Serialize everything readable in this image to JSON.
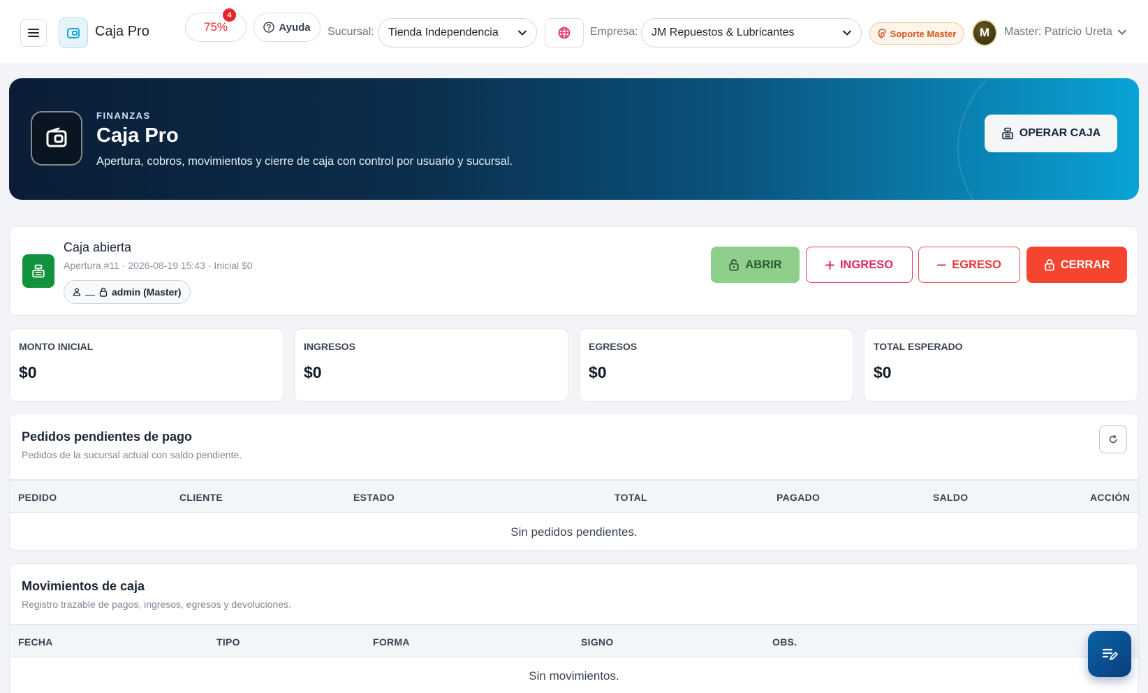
{
  "topbar": {
    "app_title": "Caja Pro",
    "progress_label": "75%",
    "progress_value": 75,
    "notification_count": "4",
    "help_label": "Ayuda",
    "branch_label": "Sucursal:",
    "branch_value": "Tienda Independencia",
    "company_label": "Empresa:",
    "company_value": "JM Repuestos & Lubricantes",
    "support_label": "Soporte Master",
    "avatar_initial": "M",
    "user_name": "Master: Patricio Ureta"
  },
  "hero": {
    "kicker": "FINANZAS",
    "title": "Caja Pro",
    "subtitle": "Apertura, cobros, movimientos y cierre de caja con control por usuario y sucursal.",
    "button_label": "OPERAR CAJA"
  },
  "caja": {
    "status_title": "Caja abierta",
    "meta": "Apertura #11 · 2026-08-19 15:43 · Inicial $0",
    "user_badge": "admin (Master)",
    "buttons": {
      "abrir": "ABRIR",
      "ingreso": "INGRESO",
      "egreso": "EGRESO",
      "cerrar": "CERRAR"
    }
  },
  "stats": [
    {
      "label": "MONTO INICIAL",
      "value": "$0"
    },
    {
      "label": "INGRESOS",
      "value": "$0"
    },
    {
      "label": "EGRESOS",
      "value": "$0"
    },
    {
      "label": "TOTAL ESPERADO",
      "value": "$0"
    }
  ],
  "pending": {
    "title": "Pedidos pendientes de pago",
    "subtitle": "Pedidos de la sucursal actual con saldo pendiente.",
    "columns": [
      "PEDIDO",
      "CLIENTE",
      "ESTADO",
      "TOTAL",
      "PAGADO",
      "SALDO",
      "ACCIÓN"
    ],
    "empty_text": "Sin pedidos pendientes."
  },
  "movements": {
    "title": "Movimientos de caja",
    "subtitle": "Registro trazable de pagos, ingresos, egresos y devoluciones.",
    "columns": [
      "FECHA",
      "TIPO",
      "FORMA",
      "SIGNO",
      "OBS."
    ],
    "empty_text": "Sin movimientos."
  },
  "colors": {
    "accent": "#0a5580",
    "success": "#12923c",
    "danger": "#f5452f",
    "pink": "#e0285f"
  },
  "icons": [
    "menu-icon",
    "wallet-icon",
    "help-icon",
    "chevron-down-icon",
    "globe-icon",
    "support-icon",
    "cash-register-icon",
    "lock-icon",
    "plus-icon",
    "minus-icon",
    "user-icon",
    "refresh-icon",
    "notes-icon"
  ]
}
